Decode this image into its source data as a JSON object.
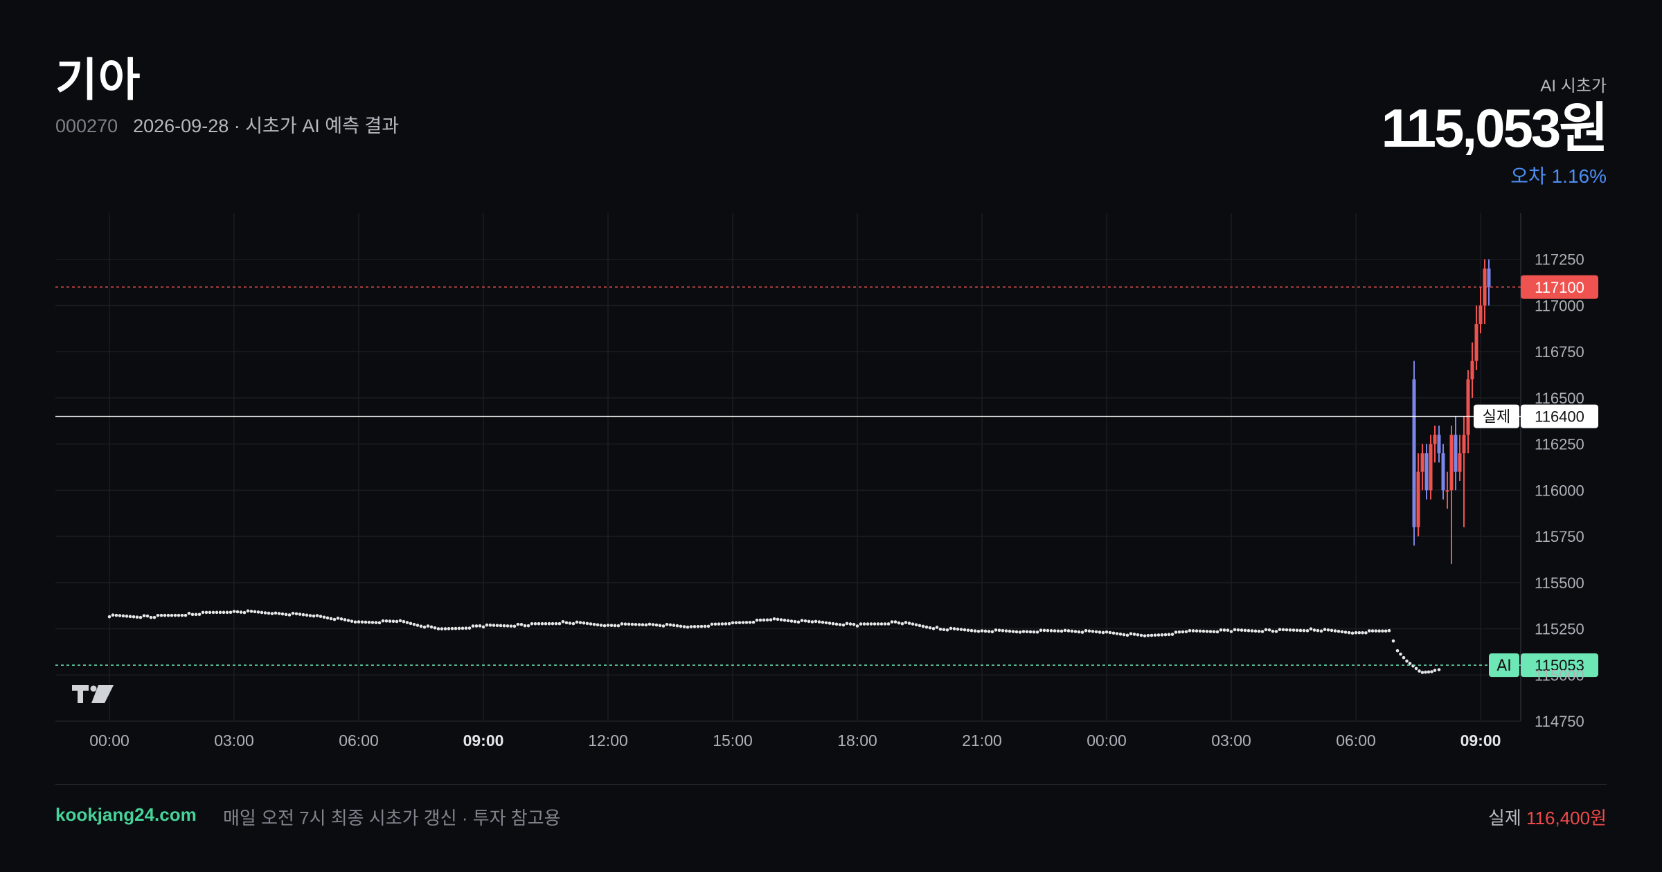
{
  "header": {
    "name": "기아",
    "code": "000270",
    "subtitle": "2026-09-28 · 시초가 AI 예측 결과"
  },
  "summary": {
    "ai_label": "AI 시초가",
    "ai_price": "115,053원",
    "error": "오차 1.16%"
  },
  "footer": {
    "site": "kookjang24.com",
    "note": "매일 오전 7시 최종 시초가 갱신 · 투자 참고용",
    "actual_label": "실제",
    "actual_value": "116,400원"
  },
  "colors": {
    "up": "#ef5350",
    "down": "#7b86e8",
    "ai": "#6ee7b7",
    "accent_blue": "#4d8ff5",
    "site_green": "#46d39a"
  },
  "chart_data": {
    "type": "line",
    "x_ticks": [
      "00:00",
      "03:00",
      "06:00",
      "09:00",
      "12:00",
      "15:00",
      "18:00",
      "21:00",
      "00:00",
      "03:00",
      "06:00",
      "09:00"
    ],
    "x_ticks_bold": [
      false,
      false,
      false,
      true,
      false,
      false,
      false,
      false,
      false,
      false,
      false,
      true
    ],
    "y_ticks": [
      117250,
      117000,
      116750,
      116500,
      116250,
      116000,
      115750,
      115500,
      115250,
      115000,
      114750
    ],
    "ylim": [
      114750,
      117500
    ],
    "grid": true,
    "price_lines": [
      {
        "name": "last",
        "value": 117100,
        "label": "117100",
        "style": "dashed",
        "color": "#ef5350"
      },
      {
        "name": "실제",
        "value": 116400,
        "label": "116400",
        "tag": "실제",
        "style": "solid",
        "color": "#ffffff"
      },
      {
        "name": "AI",
        "value": 115053,
        "label": "115053",
        "tag": "AI",
        "style": "dashed",
        "color": "#6ee7b7"
      }
    ],
    "series": [
      {
        "type": "dotted_line",
        "x_hours": [
          0,
          1,
          2,
          3,
          4,
          5,
          6,
          7,
          8,
          9,
          10,
          11,
          12,
          13,
          14,
          15,
          16,
          17,
          18,
          19,
          20,
          21,
          22,
          23,
          24,
          25,
          26,
          27,
          28,
          29,
          30,
          30.8,
          31.0,
          31.3,
          31.6,
          31.9,
          32.1
        ],
        "values": [
          115320,
          115315,
          115330,
          115345,
          115335,
          115320,
          115285,
          115290,
          115245,
          115265,
          115270,
          115285,
          115270,
          115275,
          115260,
          115280,
          115300,
          115285,
          115270,
          115285,
          115250,
          115240,
          115235,
          115240,
          115230,
          115210,
          115235,
          115240,
          115240,
          115245,
          115230,
          115240,
          115130,
          115060,
          115010,
          115020,
          115030
        ]
      },
      {
        "type": "candles",
        "x_hours": [
          31.4,
          31.5,
          31.6,
          31.7,
          31.8,
          31.9,
          32.0,
          32.1,
          32.2,
          32.3,
          32.4,
          32.5,
          32.6,
          32.7,
          32.8,
          32.9,
          33.0,
          33.1,
          33.2
        ],
        "open": [
          116600,
          115800,
          116100,
          116200,
          116000,
          116250,
          116300,
          116200,
          116000,
          116000,
          116300,
          116100,
          116200,
          116300,
          116600,
          116700,
          116900,
          117000,
          117200
        ],
        "close": [
          115800,
          116100,
          116200,
          116000,
          116250,
          116300,
          116200,
          116000,
          116000,
          116300,
          116100,
          116200,
          116300,
          116600,
          116700,
          116900,
          117000,
          117200,
          117100
        ],
        "high": [
          116700,
          116200,
          116250,
          116250,
          116300,
          116350,
          116350,
          116250,
          116100,
          116350,
          116400,
          116300,
          116400,
          116650,
          116800,
          117000,
          117100,
          117250,
          117250
        ],
        "low": [
          115700,
          115750,
          116000,
          115950,
          115950,
          116150,
          116150,
          115950,
          115900,
          115600,
          116000,
          116050,
          115800,
          116200,
          116500,
          116650,
          116850,
          116900,
          117000
        ]
      }
    ]
  }
}
